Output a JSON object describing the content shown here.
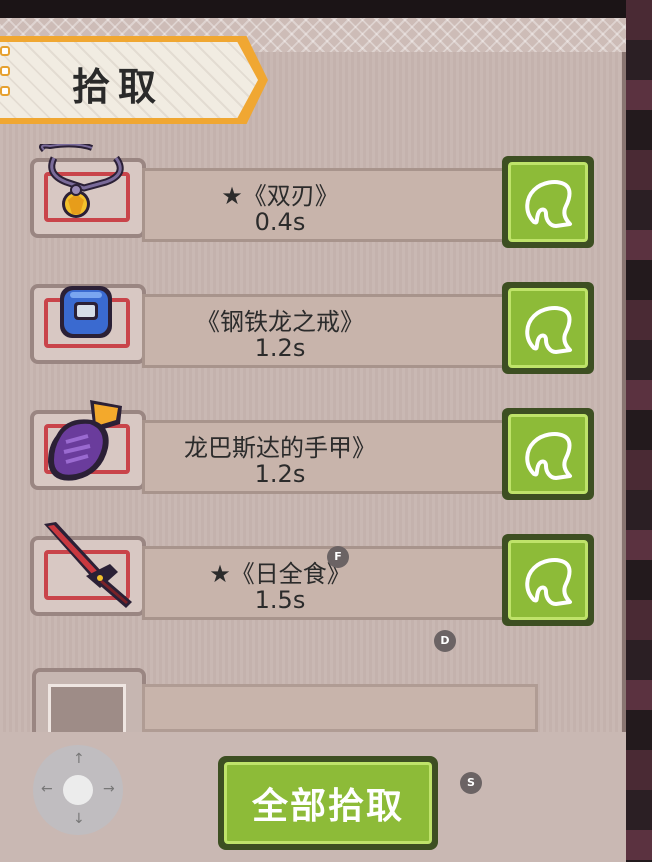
{
  "window": {
    "title": "拾取"
  },
  "items": [
    {
      "name": "★《双刃》",
      "time": "0.4s",
      "icon": "necklace-icon"
    },
    {
      "name": "《钢铁龙之戒》",
      "time": "1.2s",
      "icon": "ring-icon"
    },
    {
      "name": "龙巴斯达的手甲》",
      "time": "1.2s",
      "icon": "gauntlet-icon"
    },
    {
      "name": "★《日全食》",
      "time": "1.5s",
      "icon": "sword-icon"
    }
  ],
  "pick_button": {
    "icon": "hand-pickup-icon"
  },
  "pick_all": {
    "label": "全部拾取"
  },
  "hints": {
    "f": "F",
    "d": "D",
    "s": "S"
  },
  "joystick": {
    "up": "↑",
    "down": "↓",
    "left": "←",
    "right": "→"
  },
  "colors": {
    "accent_green": "#8dbb38",
    "banner_orange": "#f0a732",
    "slot_red": "#c9444a"
  }
}
